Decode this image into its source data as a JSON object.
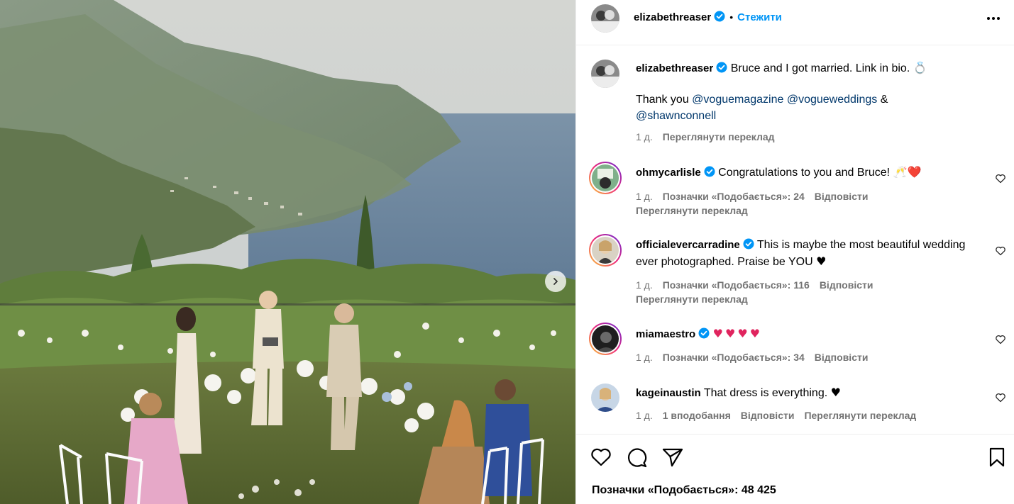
{
  "post": {
    "author": "elizabethreaser",
    "follow_label": "Стежити",
    "more_icon": "more-horizontal-icon",
    "caption_line1": "Bruce and I got married. Link in bio. 💍",
    "caption_thanks": "Thank you",
    "caption_mention1": "@voguemagazine",
    "caption_mention2": "@vogueweddings",
    "caption_amp": "&",
    "caption_mention3": "@shawnconnell",
    "caption_time": "1 д.",
    "caption_translate": "Переглянути переклад"
  },
  "comments": [
    {
      "username": "ohmycarlisle",
      "verified": true,
      "text": "Congratulations to you and Bruce! 🥂❤️",
      "time": "1 д.",
      "likes": "Позначки «Подобається»: 24",
      "reply": "Відповісти",
      "translate": "Переглянути переклад"
    },
    {
      "username": "officialevercarradine",
      "verified": true,
      "text": "This is maybe the most beautiful wedding ever photographed. Praise be YOU",
      "text_heart": "♥",
      "time": "1 д.",
      "likes": "Позначки «Подобається»: 116",
      "reply": "Відповісти",
      "translate": "Переглянути переклад"
    },
    {
      "username": "miamaestro",
      "verified": true,
      "text": "♥♥♥♥",
      "time": "1 д.",
      "likes": "Позначки «Подобається»: 34",
      "reply": "Відповісти"
    },
    {
      "username": "kageinaustin",
      "verified": false,
      "text": "That dress is everything.",
      "text_heart": "♥",
      "time": "1 д.",
      "likes": "1 вподобання",
      "reply": "Відповісти",
      "translate": "Переглянути переклад"
    }
  ],
  "footer": {
    "likes_text": "Позначки «Подобається»: 48 425"
  },
  "colors": {
    "follow": "#0095f6",
    "verified": "#0095f6",
    "mention": "#00376b",
    "muted": "#737373",
    "heart": "#e0245e"
  }
}
